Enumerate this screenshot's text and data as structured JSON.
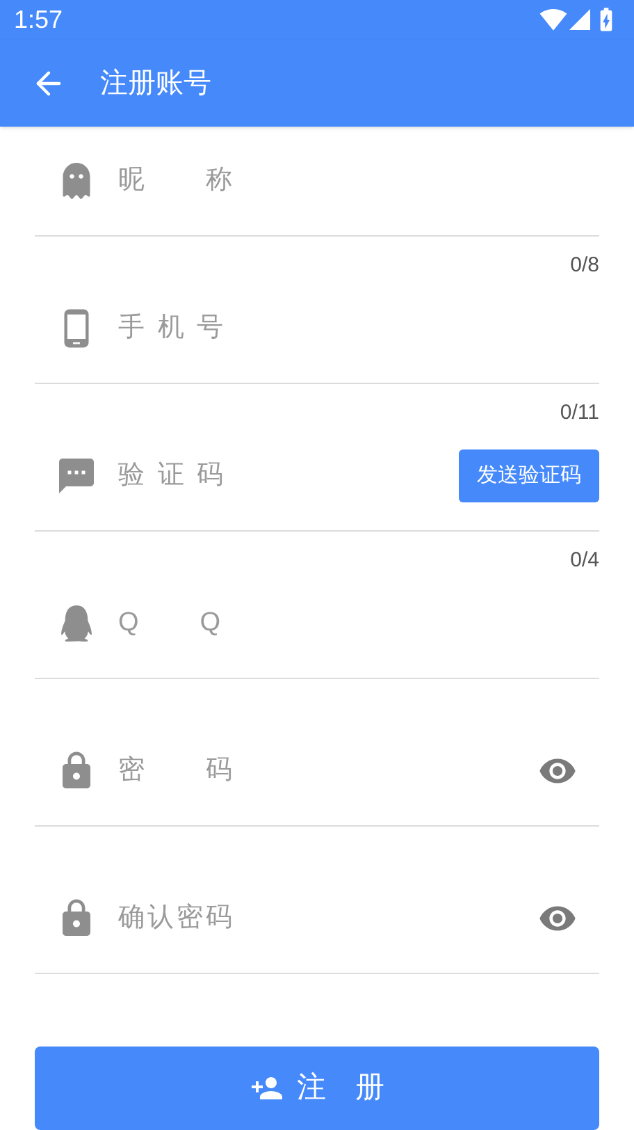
{
  "status_bar": {
    "time": "1:57"
  },
  "app_bar": {
    "title": "注册账号"
  },
  "fields": [
    {
      "kind": "nickname",
      "placeholder": "昵　　称",
      "counter": "0/8"
    },
    {
      "kind": "phone",
      "placeholder": "手 机 号",
      "counter": "0/11"
    },
    {
      "kind": "code",
      "placeholder": "验 证 码",
      "action": "发送验证码",
      "counter": "0/4"
    },
    {
      "kind": "qq",
      "placeholder": "Q　　Q"
    },
    {
      "kind": "password",
      "placeholder": "密　　码"
    },
    {
      "kind": "password",
      "placeholder": "确认密码"
    }
  ],
  "submit": {
    "label": "注　册"
  }
}
